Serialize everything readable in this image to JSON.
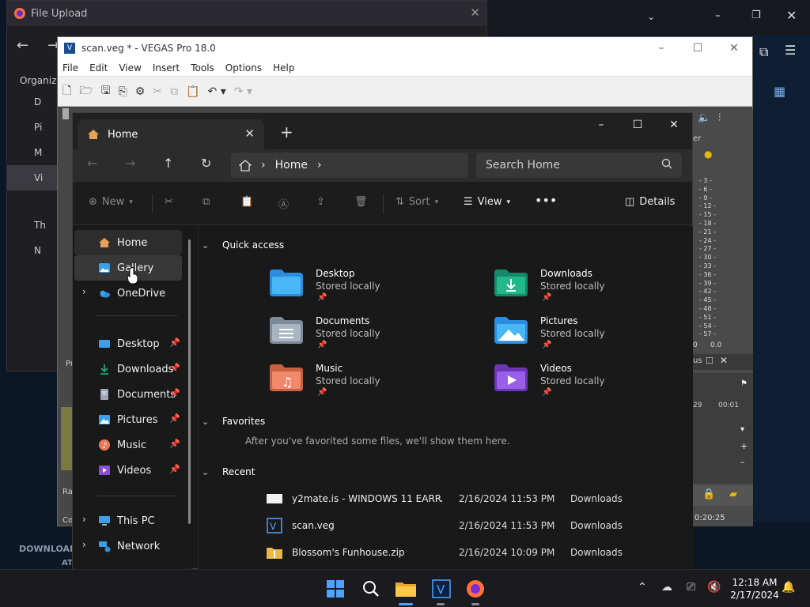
{
  "background_browser": {
    "title": "File Upload",
    "organize": "Organize",
    "side_items": [
      "D",
      "Pi",
      "M",
      "Vi"
    ],
    "tree_items": [
      "Th",
      "N"
    ],
    "bottom_text": "DOWNLOAD",
    "bottom_text2": "AT"
  },
  "vegas": {
    "title": "scan.veg * - VEGAS Pro 18.0",
    "menu": [
      "File",
      "Edit",
      "View",
      "Insert",
      "Tools",
      "Options",
      "Help"
    ],
    "meter_labels": [
      "3",
      "6",
      "9",
      "12",
      "15",
      "18",
      "21",
      "24",
      "27",
      "30",
      "33",
      "36",
      "39",
      "42",
      "45",
      "48",
      "51",
      "54",
      "57"
    ],
    "meter_bottom_left": "0",
    "meter_bottom_right": "0.0",
    "timeline_label": "00:01",
    "timeline_label2": "29",
    "time_code": "0:20:25",
    "panel_label": "er",
    "bus_label": "us",
    "left_label": "Ra",
    "left_label2": "Co",
    "left_label3": "Pr"
  },
  "explorer": {
    "tab_title": "Home",
    "address": "Home",
    "search_placeholder": "Search Home",
    "commands": {
      "new": "New",
      "sort": "Sort",
      "view": "View",
      "details": "Details"
    },
    "sidebar": {
      "top": [
        {
          "label": "Home"
        },
        {
          "label": "Gallery"
        },
        {
          "label": "OneDrive"
        }
      ],
      "pinned": [
        {
          "label": "Desktop"
        },
        {
          "label": "Downloads"
        },
        {
          "label": "Documents"
        },
        {
          "label": "Pictures"
        },
        {
          "label": "Music"
        },
        {
          "label": "Videos"
        }
      ],
      "bottom": [
        {
          "label": "This PC"
        },
        {
          "label": "Network"
        }
      ]
    },
    "quick_access": {
      "title": "Quick access",
      "items": [
        {
          "name": "Desktop",
          "sub": "Stored locally"
        },
        {
          "name": "Downloads",
          "sub": "Stored locally"
        },
        {
          "name": "Documents",
          "sub": "Stored locally"
        },
        {
          "name": "Pictures",
          "sub": "Stored locally"
        },
        {
          "name": "Music",
          "sub": "Stored locally"
        },
        {
          "name": "Videos",
          "sub": "Stored locally"
        }
      ]
    },
    "favorites": {
      "title": "Favorites",
      "empty": "After you've favorited some files, we'll show them here."
    },
    "recent": {
      "title": "Recent",
      "rows": [
        {
          "name": "y2mate.is - WINDOWS 11 EARRA...",
          "date": "2/16/2024 11:53 PM",
          "location": "Downloads"
        },
        {
          "name": "scan.veg",
          "date": "2/16/2024 11:53 PM",
          "location": "Downloads"
        },
        {
          "name": "Blossom's Funhouse.zip",
          "date": "2/16/2024 10:09 PM",
          "location": "Downloads"
        }
      ]
    }
  },
  "taskbar": {
    "time": "12:18 AM",
    "date": "2/17/2024"
  },
  "colors": {
    "accent": "#4ea1ff",
    "explorer_bg": "#191919",
    "folder_blue": "#3aa0e8",
    "downloads_green": "#1fa67a",
    "videos_purple": "#8a4fd8",
    "music_orange": "#e87a5a"
  }
}
